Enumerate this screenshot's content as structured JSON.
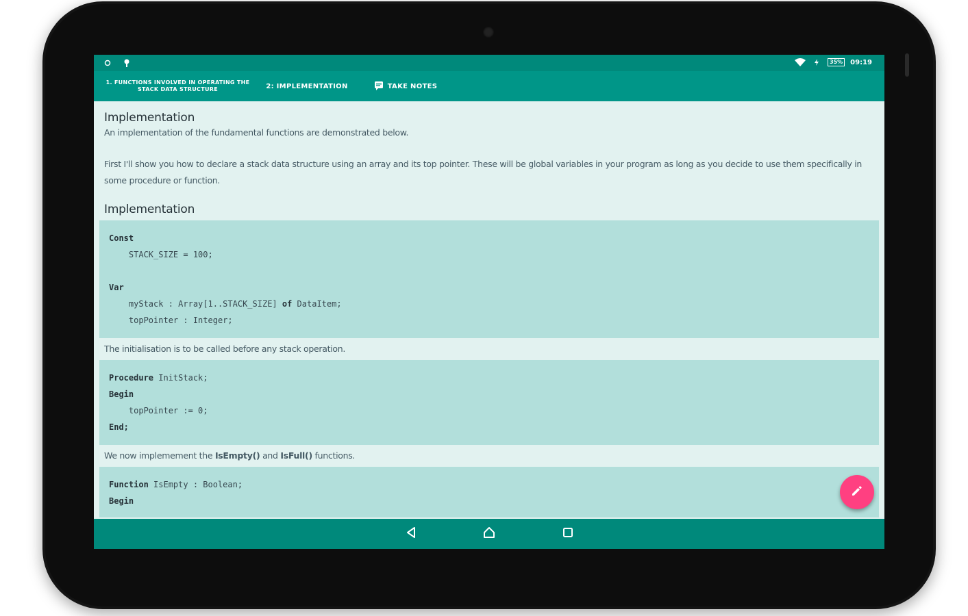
{
  "status_bar": {
    "time": "09:19",
    "battery": "35%"
  },
  "tabs": [
    {
      "label": "1. FUNCTIONS INVOLVED IN OPERATING THE STACK DATA STRUCTURE"
    },
    {
      "label": "2: IMPLEMENTATION"
    },
    {
      "label": "TAKE NOTES"
    }
  ],
  "content": {
    "heading_1": "Implementation",
    "intro": "An implementation of the fundamental functions are demonstrated below.",
    "paragraph": "First I'll show you how to declare a stack data structure using an array and its top pointer. These will be global variables in your program as long as you decide to use them specifically in some procedure or function.",
    "heading_2": "Implementation",
    "code_1": {
      "l1": "Const",
      "l2": "    STACK_SIZE = 100;",
      "l3": "Var",
      "l4a": "    myStack : Array[1..STACK_SIZE] ",
      "l4b": "of",
      "l4c": " DataItem;",
      "l5": "    topPointer : Integer;"
    },
    "init_text": "The initialisation is to be called before any stack operation.",
    "code_2": {
      "l1a": "Procedure",
      "l1b": " InitStack;",
      "l2": "Begin",
      "l3": "    topPointer := 0;",
      "l4": "End;"
    },
    "now_text_a": "We now implemement the ",
    "now_text_b": "IsEmpty()",
    "now_text_c": " and ",
    "now_text_d": "IsFull()",
    "now_text_e": " functions.",
    "code_3": {
      "l1a": "Function",
      "l1b": " IsEmpty : Boolean;",
      "l2": "Begin"
    }
  },
  "colors": {
    "primary": "#009688",
    "primary_dark": "#00897b",
    "accent": "#ff4081",
    "code_bg": "#b2dfdb",
    "page_bg": "#e2f2f0"
  },
  "icons": {
    "fab": "pencil-icon",
    "back": "back-triangle-icon",
    "home": "home-icon",
    "recents": "recents-square-icon",
    "notes": "notes-icon",
    "wifi": "wifi-icon"
  }
}
